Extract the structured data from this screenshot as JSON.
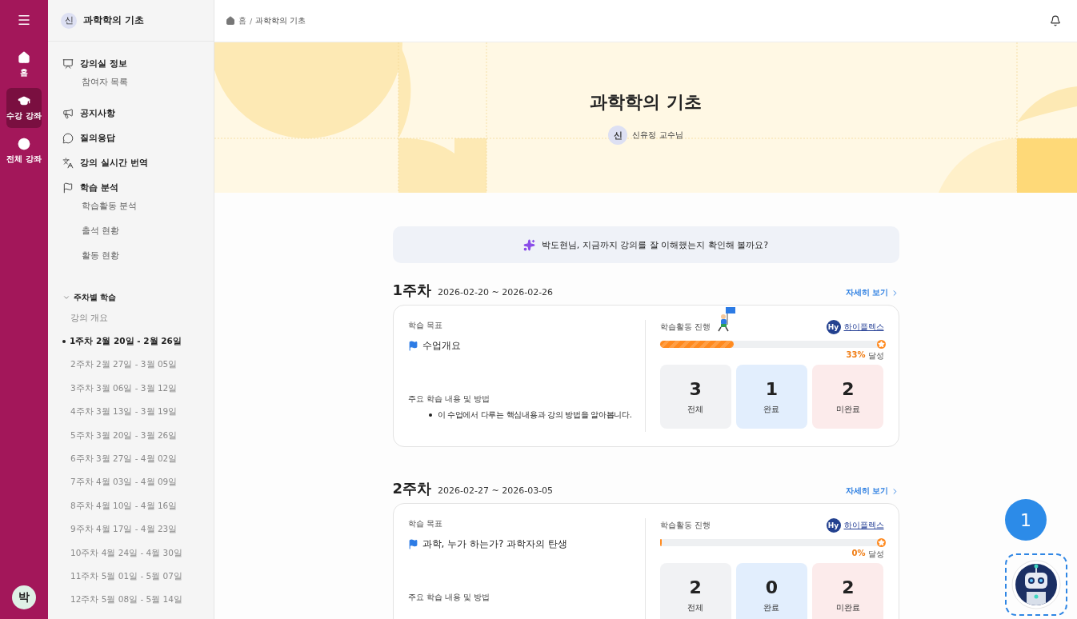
{
  "rail": {
    "items": [
      {
        "label": "홈",
        "selected": false
      },
      {
        "label": "수강 강좌",
        "selected": true
      },
      {
        "label": "전체 강좌",
        "selected": false
      }
    ],
    "avatar": "박"
  },
  "sidebar": {
    "course_badge": "신",
    "course_title": "과학학의 기초",
    "items": [
      {
        "label": "강의실 정보",
        "children": [
          {
            "label": "참여자 목록"
          }
        ]
      },
      {
        "label": "공지사항"
      },
      {
        "label": "질의응답"
      },
      {
        "label": "강의 실시간 번역"
      },
      {
        "label": "학습 분석",
        "children": [
          {
            "label": "학습활동 분석"
          },
          {
            "label": "출석 현황"
          },
          {
            "label": "활동 현황"
          }
        ]
      }
    ],
    "weeks_section": {
      "title": "주차별 학습",
      "expanded": true,
      "items": [
        {
          "label": "강의 개요",
          "selected": false
        },
        {
          "label": "1주차 2월 20일 - 2월 26일",
          "selected": true
        },
        {
          "label": "2주차 2월 27일 - 3월 05일",
          "selected": false
        },
        {
          "label": "3주차 3월 06일 - 3월 12일",
          "selected": false
        },
        {
          "label": "4주차 3월 13일 - 3월 19일",
          "selected": false
        },
        {
          "label": "5주차 3월 20일 - 3월 26일",
          "selected": false
        },
        {
          "label": "6주차 3월 27일 - 4월 02일",
          "selected": false
        },
        {
          "label": "7주차 4월 03일 - 4월 09일",
          "selected": false
        },
        {
          "label": "8주차 4월 10일 - 4월 16일",
          "selected": false
        },
        {
          "label": "9주차 4월 17일 - 4월 23일",
          "selected": false
        },
        {
          "label": "10주차 4월 24일 - 4월 30일",
          "selected": false
        },
        {
          "label": "11주차 5월 01일 - 5월 07일",
          "selected": false
        },
        {
          "label": "12주차 5월 08일 - 5월 14일",
          "selected": false
        }
      ]
    }
  },
  "breadcrumb": [
    "홈",
    "/",
    "과학학의 기초"
  ],
  "banner": {
    "title": "과학학의 기초",
    "professor_badge": "신",
    "professor": "신유정 교수님"
  },
  "notice": "박도현님, 지금까지 강의를 잘 이해했는지 확인해 볼까요?",
  "weeks": [
    {
      "title": "1주차",
      "dates": "2026-02-20 ~ 2026-02-26",
      "link": "자세히 보기",
      "goal_label": "학습 목표",
      "goal": "수업개요",
      "methods_label": "주요 학습 내용 및 방법",
      "bullets": [
        "이 수업에서 다루는 핵심내용과 강의 방법을 알아봅니다."
      ],
      "progress_label": "학습활동 진행",
      "brand_badge": "Hy",
      "brand": "하이플렉스",
      "level": 0.33,
      "percent": "33%",
      "achieved": "달성",
      "stats": [
        {
          "kind": "total",
          "value": "3",
          "label": "전체"
        },
        {
          "kind": "done",
          "value": "1",
          "label": "완료"
        },
        {
          "kind": "todo",
          "value": "2",
          "label": "미완료"
        }
      ]
    },
    {
      "title": "2주차",
      "dates": "2026-02-27 ~ 2026-03-05",
      "link": "자세히 보기",
      "goal_label": "학습 목표",
      "goal": "과학, 누가 하는가? 과학자의 탄생",
      "methods_label": "주요 학습 내용 및 방법",
      "progress_label": "학습활동 진행",
      "brand_badge": "Hy",
      "brand": "하이플렉스",
      "level": 0,
      "percent": "0%",
      "achieved": "달성",
      "stats": [
        {
          "kind": "total",
          "value": "2",
          "label": "전체"
        },
        {
          "kind": "done",
          "value": "0",
          "label": "완료"
        },
        {
          "kind": "todo",
          "value": "2",
          "label": "미완료"
        }
      ]
    }
  ],
  "floating": {
    "badge": "1"
  }
}
